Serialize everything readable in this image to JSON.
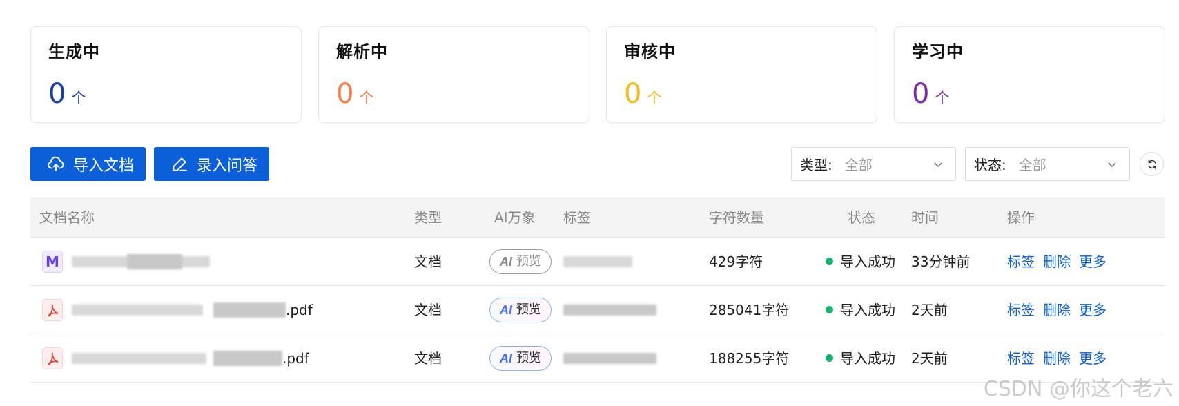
{
  "stats": [
    {
      "title": "生成中",
      "count": "0",
      "unit": "个",
      "color": "#1a3fa6"
    },
    {
      "title": "解析中",
      "count": "0",
      "unit": "个",
      "color": "#f5804a"
    },
    {
      "title": "审核中",
      "count": "0",
      "unit": "个",
      "color": "#f4be1e"
    },
    {
      "title": "学习中",
      "count": "0",
      "unit": "个",
      "color": "#7b2fa4"
    }
  ],
  "toolbar": {
    "import_label": "导入文档",
    "qa_label": "录入问答",
    "type_filter": {
      "label": "类型:",
      "value": "全部"
    },
    "status_filter": {
      "label": "状态:",
      "value": "全部"
    }
  },
  "table": {
    "headers": {
      "name": "文档名称",
      "type": "类型",
      "ai": "AI万象",
      "tags": "标签",
      "chars": "字符数量",
      "status": "状态",
      "time": "时间",
      "ops": "操作"
    },
    "rows": [
      {
        "file_type": "markdown",
        "icon": "M",
        "name_suffix": "",
        "type": "文档",
        "ai_label": "预览",
        "ai_style": "gray",
        "chars": "429字符",
        "status": "导入成功",
        "time": "33分钟前",
        "ops": [
          "标签",
          "删除",
          "更多"
        ]
      },
      {
        "file_type": "pdf",
        "icon": "pdf-icon",
        "name_suffix": ".pdf",
        "type": "文档",
        "ai_label": "预览",
        "ai_style": "color",
        "chars": "285041字符",
        "status": "导入成功",
        "time": "2天前",
        "ops": [
          "标签",
          "删除",
          "更多"
        ]
      },
      {
        "file_type": "pdf",
        "icon": "pdf-icon",
        "name_suffix": ".pdf",
        "type": "文档",
        "ai_label": "预览",
        "ai_style": "color",
        "chars": "188255字符",
        "status": "导入成功",
        "time": "2天前",
        "ops": [
          "标签",
          "删除",
          "更多"
        ]
      }
    ]
  },
  "ai_mark": "AI",
  "watermark": "CSDN @你这个老六",
  "colors": {
    "primary": "#0b5fd8",
    "success": "#16b36e"
  }
}
